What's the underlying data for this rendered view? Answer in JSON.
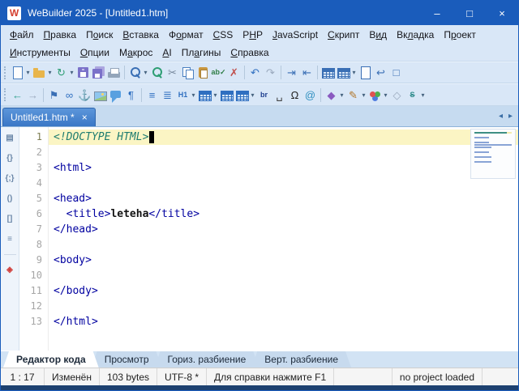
{
  "window": {
    "title": "WeBuilder 2025 - [Untitled1.htm]",
    "icon_letter": "W",
    "buttons": [
      {
        "name": "minimize",
        "glyph": "–"
      },
      {
        "name": "maximize",
        "glyph": "□"
      },
      {
        "name": "close",
        "glyph": "×"
      }
    ]
  },
  "menu": {
    "row1": [
      {
        "id": "file",
        "label": "Файл",
        "accel": 0
      },
      {
        "id": "edit",
        "label": "Правка",
        "accel": 0
      },
      {
        "id": "search",
        "label": "Поиск",
        "accel": 1
      },
      {
        "id": "insert",
        "label": "Вставка",
        "accel": 0
      },
      {
        "id": "format",
        "label": "Формат",
        "accel": 1
      },
      {
        "id": "css",
        "label": "CSS",
        "accel": 0
      },
      {
        "id": "php",
        "label": "PHP",
        "accel": 1
      },
      {
        "id": "javascript",
        "label": "JavaScript",
        "accel": 0
      },
      {
        "id": "script",
        "label": "Скрипт",
        "accel": 0
      },
      {
        "id": "view",
        "label": "Вид",
        "accel": 1
      },
      {
        "id": "tab",
        "label": "Вкладка",
        "accel": 2
      },
      {
        "id": "project",
        "label": "Проект",
        "accel": 1
      }
    ],
    "row2": [
      {
        "id": "tools",
        "label": "Инструменты",
        "accel": 0
      },
      {
        "id": "options",
        "label": "Опции",
        "accel": 0
      },
      {
        "id": "macros",
        "label": "Макрос",
        "accel": 1
      },
      {
        "id": "ai",
        "label": "AI",
        "accel": 0
      },
      {
        "id": "plugins",
        "label": "Плагины",
        "accel": 2
      },
      {
        "id": "help",
        "label": "Справка",
        "accel": 0
      }
    ]
  },
  "toolbar1": [
    {
      "name": "new-document",
      "kind": "page",
      "color": "#4a7fc0",
      "dd": true
    },
    {
      "name": "open-file",
      "kind": "folder",
      "color": "#e8b54b",
      "dd": true
    },
    {
      "name": "reopen-file",
      "kind": "glyph",
      "glyph": "↻",
      "color": "#2e9e74",
      "dd": true
    },
    {
      "name": "save",
      "kind": "floppy",
      "color": "#7b72c9"
    },
    {
      "name": "save-all",
      "kind": "floppy2",
      "color": "#7b72c9"
    },
    {
      "name": "print",
      "kind": "printer"
    },
    {
      "sep": true
    },
    {
      "name": "find",
      "kind": "search",
      "color": "#3a6fb5",
      "dd": true
    },
    {
      "name": "find-replace",
      "kind": "search",
      "color": "#2e9e74"
    },
    {
      "name": "cut",
      "kind": "glyph",
      "glyph": "✂",
      "color": "#77889c"
    },
    {
      "name": "copy",
      "kind": "copy",
      "color": "#4a7fc0"
    },
    {
      "name": "paste",
      "kind": "paste"
    },
    {
      "name": "spell-check",
      "kind": "text",
      "glyph": "ab✓",
      "color": "#2e7d46"
    },
    {
      "name": "delete",
      "kind": "glyph",
      "glyph": "✗",
      "color": "#c0504d"
    },
    {
      "sep": true
    },
    {
      "name": "undo",
      "kind": "glyph",
      "glyph": "↶",
      "color": "#2f6fc0"
    },
    {
      "name": "redo",
      "kind": "glyph",
      "glyph": "↷",
      "color": "#9aa9bd"
    },
    {
      "sep": true
    },
    {
      "name": "indent",
      "kind": "glyph",
      "glyph": "⇥",
      "color": "#3a6fb5"
    },
    {
      "name": "outdent",
      "kind": "glyph",
      "glyph": "⇤",
      "color": "#3a6fb5"
    },
    {
      "sep": true
    },
    {
      "name": "code-explorer",
      "kind": "table",
      "color": "#3a6fb5"
    },
    {
      "name": "file-browser",
      "kind": "table",
      "color": "#3a6fb5",
      "dd": true
    },
    {
      "name": "code-snippets",
      "kind": "page",
      "color": "#3a6fb5"
    },
    {
      "name": "word-wrap",
      "kind": "glyph",
      "glyph": "↩",
      "color": "#3a6fb5"
    },
    {
      "name": "fullscreen",
      "kind": "glyph",
      "glyph": "□",
      "color": "#3a6fb5"
    }
  ],
  "toolbar2": [
    {
      "name": "navigate-back",
      "kind": "glyph",
      "glyph": "←",
      "color": "#2fa08c"
    },
    {
      "name": "navigate-forward",
      "kind": "glyph",
      "glyph": "→",
      "color": "#9aa9bd"
    },
    {
      "sep": true
    },
    {
      "name": "bookmark",
      "kind": "glyph",
      "glyph": "⚑",
      "color": "#3a6fb5"
    },
    {
      "name": "hyperlink",
      "kind": "glyph",
      "glyph": "∞",
      "color": "#2f6fc0"
    },
    {
      "name": "anchor",
      "kind": "glyph",
      "glyph": "⚓",
      "color": "#3a6fb5"
    },
    {
      "name": "insert-image",
      "kind": "image"
    },
    {
      "name": "insert-comment",
      "kind": "bubble",
      "color": "#58a0e0"
    },
    {
      "name": "paragraph",
      "kind": "glyph",
      "glyph": "¶",
      "color": "#2f6fc0"
    },
    {
      "sep": true
    },
    {
      "name": "unordered-list",
      "kind": "glyph",
      "glyph": "≡",
      "color": "#2f6fc0"
    },
    {
      "name": "ordered-list",
      "kind": "glyph",
      "glyph": "≣",
      "color": "#2f6fc0"
    },
    {
      "name": "heading-1",
      "kind": "text",
      "glyph": "H1",
      "color": "#2f6fc0",
      "dd": true
    },
    {
      "name": "insert-table",
      "kind": "table",
      "color": "#2f6fc0",
      "dd": true
    },
    {
      "name": "insert-frame",
      "kind": "table",
      "color": "#2f6fc0"
    },
    {
      "name": "insert-div",
      "kind": "table",
      "color": "#2f6fc0",
      "dd": true
    },
    {
      "name": "line-break",
      "kind": "text",
      "glyph": "br",
      "color": "#1f3f8f"
    },
    {
      "name": "non-breaking-space",
      "kind": "glyph",
      "glyph": "␣",
      "color": "#444444"
    },
    {
      "name": "special-character",
      "kind": "glyph",
      "glyph": "Ω",
      "color": "#222222"
    },
    {
      "name": "email-link",
      "kind": "glyph",
      "glyph": "@",
      "color": "#2e8fbf"
    },
    {
      "sep": true
    },
    {
      "name": "quick-color",
      "kind": "glyph",
      "glyph": "◆",
      "color": "#8a5ac0",
      "dd": true
    },
    {
      "name": "highlighter",
      "kind": "glyph",
      "glyph": "✎",
      "color": "#b0762a",
      "dd": true
    },
    {
      "name": "color-picker",
      "kind": "palette",
      "dd": true
    },
    {
      "name": "code-cleaner",
      "kind": "glyph",
      "glyph": "◇",
      "color": "#9aa9bd"
    },
    {
      "name": "strikethrough",
      "kind": "text",
      "glyph": "S",
      "color": "#2e8b8b",
      "dd": true,
      "strike": true
    }
  ],
  "side_toolbar": [
    {
      "name": "clipboard-panel",
      "glyph": "▤"
    },
    {
      "name": "code-snippets-panel",
      "glyph": "{}"
    },
    {
      "name": "code-templates-panel",
      "glyph": "{;}"
    },
    {
      "name": "parens-panel",
      "glyph": "()"
    },
    {
      "name": "brackets-panel",
      "glyph": "[]"
    },
    {
      "name": "document-structure-panel",
      "glyph": "≡"
    },
    {
      "sep": true
    },
    {
      "name": "html-validator-panel",
      "glyph": "◈",
      "color": "#d1403c"
    }
  ],
  "document_tabs": [
    {
      "id": "untitled1",
      "label": "Untitled1.htm *",
      "close_glyph": "×",
      "active": true
    }
  ],
  "tab_scroll": {
    "left": "◂",
    "right": "▸"
  },
  "editor": {
    "lines": [
      {
        "n": 1,
        "current": true,
        "segs": [
          {
            "t": "<!DOCTYPE HTML>",
            "c": "doctype"
          }
        ]
      },
      {
        "n": 2,
        "segs": []
      },
      {
        "n": 3,
        "segs": [
          {
            "t": "<html>",
            "c": "tag"
          }
        ]
      },
      {
        "n": 4,
        "segs": []
      },
      {
        "n": 5,
        "segs": [
          {
            "t": "<head>",
            "c": "tag"
          }
        ]
      },
      {
        "n": 6,
        "segs": [
          {
            "t": "  ",
            "c": "plain"
          },
          {
            "t": "<title>",
            "c": "tag"
          },
          {
            "t": "leteha",
            "c": "text"
          },
          {
            "t": "</title>",
            "c": "tag"
          }
        ]
      },
      {
        "n": 7,
        "segs": [
          {
            "t": "</head>",
            "c": "tag"
          }
        ]
      },
      {
        "n": 8,
        "segs": []
      },
      {
        "n": 9,
        "segs": [
          {
            "t": "<body>",
            "c": "tag"
          }
        ]
      },
      {
        "n": 10,
        "segs": []
      },
      {
        "n": 11,
        "segs": [
          {
            "t": "</body>",
            "c": "tag"
          }
        ]
      },
      {
        "n": 12,
        "segs": []
      },
      {
        "n": 13,
        "segs": [
          {
            "t": "</html>",
            "c": "tag"
          }
        ]
      }
    ]
  },
  "view_tabs": [
    {
      "id": "code-editor",
      "label": "Редактор кода",
      "active": true
    },
    {
      "id": "preview",
      "label": "Просмотр"
    },
    {
      "id": "horizontal-split",
      "label": "Гориз. разбиение"
    },
    {
      "id": "vertical-split",
      "label": "Верт. разбиение"
    }
  ],
  "status": {
    "cursor": "1 : 17",
    "modified": "Изменён",
    "size": "103 bytes",
    "encoding": "UTF-8 *",
    "hint": "Для справки нажмите F1",
    "project": "no project loaded"
  }
}
